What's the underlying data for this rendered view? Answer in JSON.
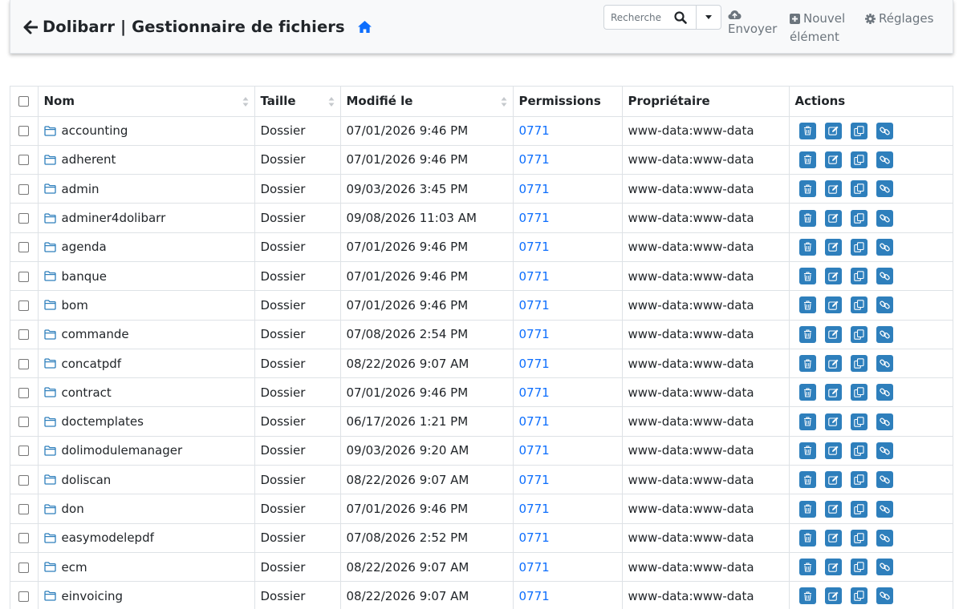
{
  "header": {
    "title": "Dolibarr | Gestionnaire de fichiers",
    "search_placeholder": "Recherche",
    "upload_label": "Envoyer",
    "new_label_line1": "Nouvel",
    "new_label_line2": "élément",
    "settings_label": "Réglages"
  },
  "table": {
    "columns": [
      "",
      "Nom",
      "Taille",
      "Modifié le",
      "Permissions",
      "Propriétaire",
      "Actions"
    ],
    "rows": [
      {
        "name": "accounting",
        "size": "Dossier",
        "modified": "07/01/2026 9:46 PM",
        "perms": "0771",
        "owner": "www-data:www-data"
      },
      {
        "name": "adherent",
        "size": "Dossier",
        "modified": "07/01/2026 9:46 PM",
        "perms": "0771",
        "owner": "www-data:www-data"
      },
      {
        "name": "admin",
        "size": "Dossier",
        "modified": "09/03/2026 3:45 PM",
        "perms": "0771",
        "owner": "www-data:www-data"
      },
      {
        "name": "adminer4dolibarr",
        "size": "Dossier",
        "modified": "09/08/2026 11:03 AM",
        "perms": "0771",
        "owner": "www-data:www-data"
      },
      {
        "name": "agenda",
        "size": "Dossier",
        "modified": "07/01/2026 9:46 PM",
        "perms": "0771",
        "owner": "www-data:www-data"
      },
      {
        "name": "banque",
        "size": "Dossier",
        "modified": "07/01/2026 9:46 PM",
        "perms": "0771",
        "owner": "www-data:www-data"
      },
      {
        "name": "bom",
        "size": "Dossier",
        "modified": "07/01/2026 9:46 PM",
        "perms": "0771",
        "owner": "www-data:www-data"
      },
      {
        "name": "commande",
        "size": "Dossier",
        "modified": "07/08/2026 2:54 PM",
        "perms": "0771",
        "owner": "www-data:www-data"
      },
      {
        "name": "concatpdf",
        "size": "Dossier",
        "modified": "08/22/2026 9:07 AM",
        "perms": "0771",
        "owner": "www-data:www-data"
      },
      {
        "name": "contract",
        "size": "Dossier",
        "modified": "07/01/2026 9:46 PM",
        "perms": "0771",
        "owner": "www-data:www-data"
      },
      {
        "name": "doctemplates",
        "size": "Dossier",
        "modified": "06/17/2026 1:21 PM",
        "perms": "0771",
        "owner": "www-data:www-data"
      },
      {
        "name": "dolimodulemanager",
        "size": "Dossier",
        "modified": "09/03/2026 9:20 AM",
        "perms": "0771",
        "owner": "www-data:www-data"
      },
      {
        "name": "doliscan",
        "size": "Dossier",
        "modified": "08/22/2026 9:07 AM",
        "perms": "0771",
        "owner": "www-data:www-data"
      },
      {
        "name": "don",
        "size": "Dossier",
        "modified": "07/01/2026 9:46 PM",
        "perms": "0771",
        "owner": "www-data:www-data"
      },
      {
        "name": "easymodelepdf",
        "size": "Dossier",
        "modified": "07/08/2026 2:52 PM",
        "perms": "0771",
        "owner": "www-data:www-data"
      },
      {
        "name": "ecm",
        "size": "Dossier",
        "modified": "08/22/2026 9:07 AM",
        "perms": "0771",
        "owner": "www-data:www-data"
      },
      {
        "name": "einvoicing",
        "size": "Dossier",
        "modified": "08/22/2026 9:07 AM",
        "perms": "0771",
        "owner": "www-data:www-data"
      }
    ]
  },
  "colors": {
    "accent": "#0d6efd",
    "action_button": "#2e7fbc",
    "navbar_bg": "#f8f9fa"
  },
  "icons": {
    "back": "arrow-left-icon",
    "home": "home-icon",
    "search": "search-icon",
    "dropdown": "caret-down-icon",
    "upload": "cloud-upload-icon",
    "new": "plus-square-icon",
    "settings": "gear-icon",
    "folder": "folder-icon",
    "delete": "trash-icon",
    "rename": "edit-icon",
    "copy": "copy-icon",
    "link": "link-icon"
  }
}
